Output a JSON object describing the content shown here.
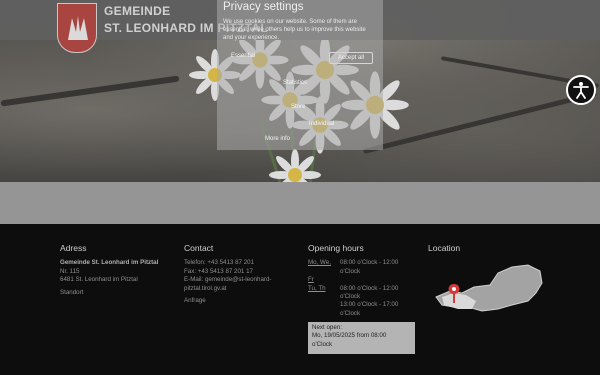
{
  "brand": {
    "line1": "GEMEINDE",
    "line2": "ST. LEONHARD IM PITZTAL"
  },
  "privacy": {
    "title": "Privacy settings",
    "text": "We use cookies on our website. Some of them are essential, while others help us to improve this website and your experience.",
    "essential": "Essential",
    "statistics": "Statistics",
    "store": "Store",
    "individual": "Individual",
    "accept": "Accept all",
    "more": "More info"
  },
  "footer": {
    "address": {
      "heading": "Adress",
      "name": "Gemeinde St. Leonhard im Pitztal",
      "street": "Nr. 115",
      "city": "6481 St. Leonhard im Pitztal",
      "location_link": "Standort"
    },
    "contact": {
      "heading": "Contact",
      "phone": "Telefon: +43 5413 87 201",
      "fax": "Fax: +43 5413 87 201 17",
      "email_line1": "E-Mail: gemeinde@st-leonhard-",
      "email_line2": "pitztal.tirol.gv.at",
      "inquiry_link": "Anfrage"
    },
    "hours": {
      "heading": "Opening hours",
      "rows": [
        {
          "days": "Mo, We,",
          "time": "08:00 o'Clock - 12:00"
        },
        {
          "days": "",
          "time": "o'Clock"
        },
        {
          "days": "Fr",
          "time": ""
        },
        {
          "days": "Tu, Th",
          "time": "08:00 o'Clock - 12:00"
        },
        {
          "days": "",
          "time": "o'Clock"
        },
        {
          "days": "",
          "time": "13:00 o'Clock - 17:00"
        },
        {
          "days": "",
          "time": "o'Clock"
        }
      ],
      "next_label": "Next open:",
      "next_value": "Mo, 19/05/2025 from 08:00",
      "next_value2": "o'Clock"
    },
    "location": {
      "heading": "Location"
    }
  },
  "icons": {
    "accessibility": "accessibility-icon",
    "map_pin": "map-pin-icon",
    "coat_of_arms": "coat-of-arms-icon"
  },
  "colors": {
    "footer_bg": "#0d0d0d",
    "banner": "#9b9b9b",
    "logo_red": "#b43a34",
    "pin": "#d23a3a"
  }
}
